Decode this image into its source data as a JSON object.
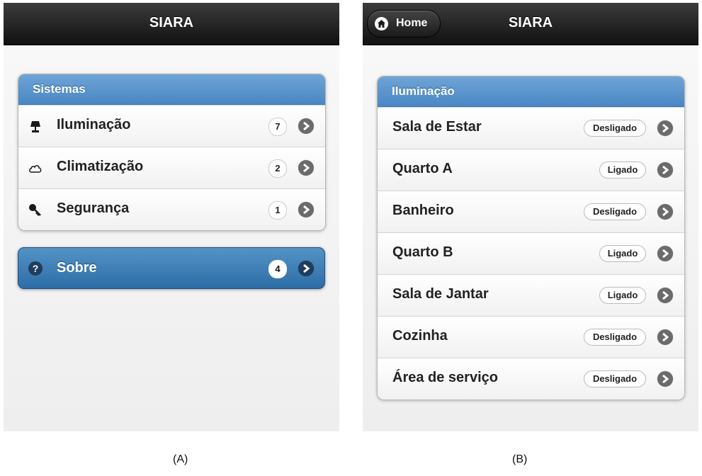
{
  "screen_a": {
    "header_title": "SIARA",
    "list_header": "Sistemas",
    "items": [
      {
        "label": "Iluminação",
        "count": "7",
        "icon": "lamp-icon"
      },
      {
        "label": "Climatização",
        "count": "2",
        "icon": "cloud-icon"
      },
      {
        "label": "Segurança",
        "count": "1",
        "icon": "key-icon"
      }
    ],
    "about": {
      "label": "Sobre",
      "count": "4",
      "icon": "help-icon"
    },
    "caption": "(A)"
  },
  "screen_b": {
    "header_title": "SIARA",
    "home_label": "Home",
    "list_header": "Iluminação",
    "items": [
      {
        "label": "Sala de Estar",
        "status": "Desligado"
      },
      {
        "label": "Quarto A",
        "status": "Ligado"
      },
      {
        "label": "Banheiro",
        "status": "Desligado"
      },
      {
        "label": "Quarto B",
        "status": "Ligado"
      },
      {
        "label": "Sala de Jantar",
        "status": "Ligado"
      },
      {
        "label": "Cozinha",
        "status": "Desligado"
      },
      {
        "label": "Área de serviço",
        "status": "Desligado"
      }
    ],
    "caption": "(B)"
  },
  "colors": {
    "list_header_blue": "#5b96cd",
    "active_button_blue": "#3f7fb6",
    "header_black": "#1a1a1a"
  }
}
